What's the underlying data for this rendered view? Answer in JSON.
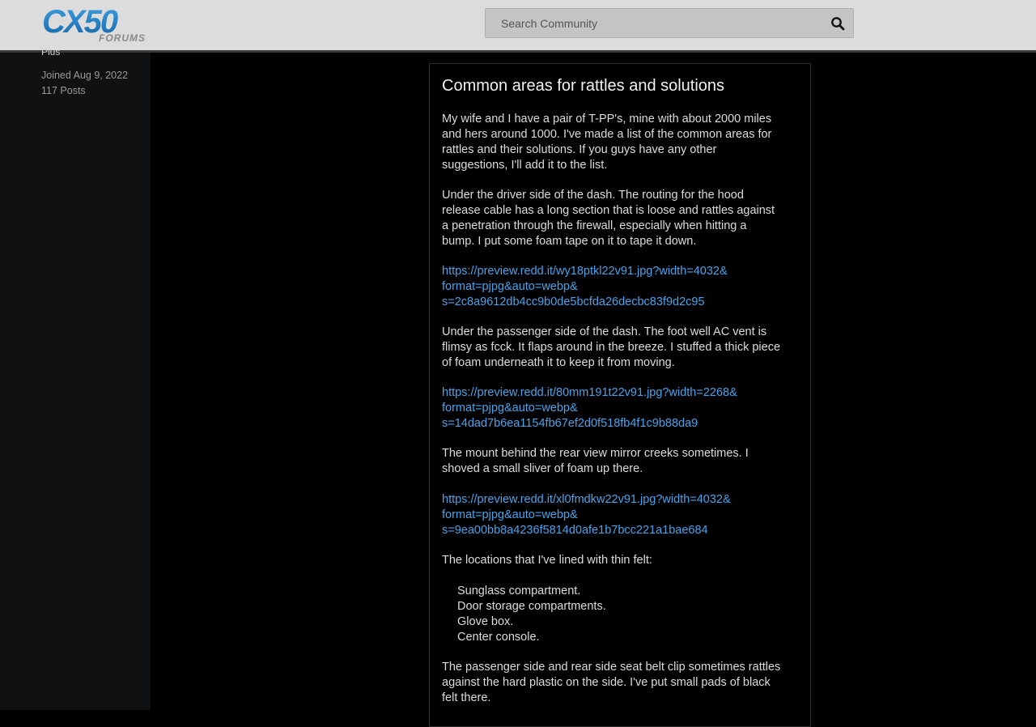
{
  "header": {
    "logo_main": "CX50",
    "logo_sub": "FORUMS",
    "search_placeholder": "Search Community"
  },
  "sidebar": {
    "rank": "Plus",
    "joined": "Joined Aug 9, 2022",
    "posts": "117 Posts"
  },
  "post": {
    "title": "Common areas for rattles and solutions",
    "p1": [
      "My wife and I have a pair of T-PP's, mine with about 2000 miles",
      "and hers around 1000. I've made a list of the common areas for",
      "rattles and their solutions. If you guys have any other",
      "suggestions, I'll add it to the list."
    ],
    "p2": [
      "Under the driver side of the dash. The routing for the hood",
      "release cable has a long section that is loose and rattles against",
      "a penetration through the firewall, especially when hitting a",
      "bump. I put some foam tape on it to tape it down."
    ],
    "link1": [
      "https://preview.redd.it/wy18ptkl22v91.jpg?width=4032&",
      "format=pjpg&auto=webp&",
      "s=2c8a9612db4cc9b0de5bcfda26decbc83f9d2c95"
    ],
    "p3": [
      "Under the passenger side of the dash. The foot well AC vent is",
      "flimsy as fcck. It flaps around in the breeze. I stuffed a thick piece",
      "of foam underneath it to keep it from moving."
    ],
    "link2": [
      "https://preview.redd.it/80mm191t22v91.jpg?width=2268&",
      "format=pjpg&auto=webp&",
      "s=14dad7b6ea1154fb67ef2d0f518fb4f1c9b88da9"
    ],
    "p4": [
      "The mount behind the rear view mirror creeks sometimes. I",
      "shoved a small sliver of foam up there."
    ],
    "link3": [
      "https://preview.redd.it/xl0fmdkw22v91.jpg?width=4032&",
      "format=pjpg&auto=webp&",
      "s=9ea00bb8a4236f5814d0afe1b7bcc221a1bae684"
    ],
    "p5": "The locations that I've lined with thin felt:",
    "felt_list": [
      "Sunglass compartment.",
      "Door storage compartments.",
      "Glove box.",
      "Center console."
    ],
    "p6": [
      "The passenger side and rear side seat belt clip sometimes rattles",
      "against the hard plastic on the side. I've put small pads of black",
      "felt there."
    ]
  },
  "colors": {
    "header_bg": "#dcdcdc",
    "logo_blue": "#1f80c4",
    "link": "#4aa3ea",
    "page_bg": "#000000"
  },
  "icons": {
    "search": "search-icon"
  }
}
